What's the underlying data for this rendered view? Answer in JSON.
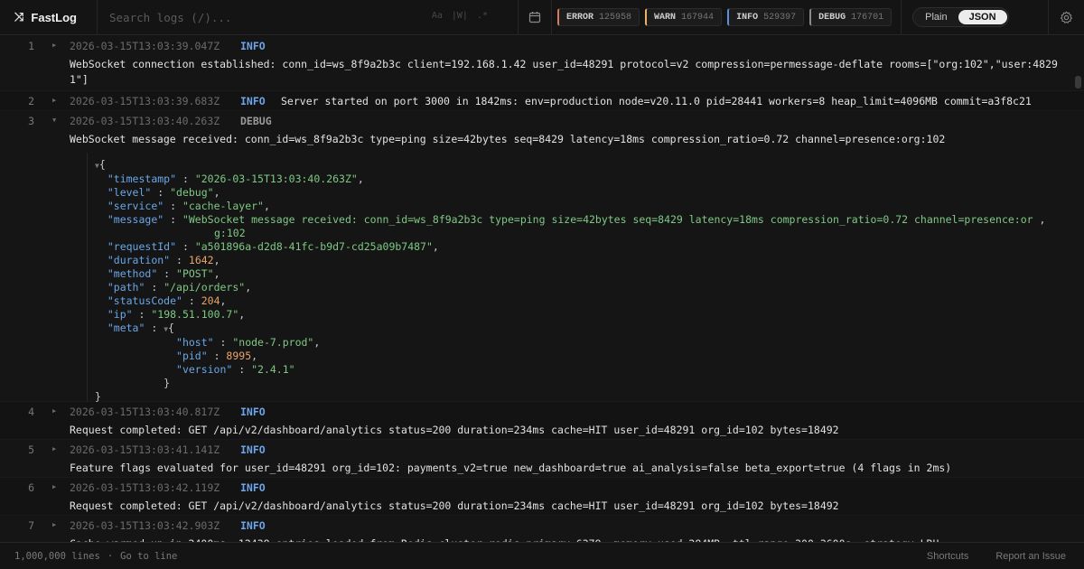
{
  "header": {
    "brand_icon": "branch-arrows-icon",
    "brand_name": "FastLog",
    "search_placeholder": "Search logs (/)...",
    "search_mods": [
      "Aa",
      "|W|",
      ".*"
    ],
    "calendar_icon": "calendar-icon",
    "badges": [
      {
        "label": "ERROR",
        "count": "125958",
        "color": "#d67a5b"
      },
      {
        "label": "WARN",
        "count": "167944",
        "color": "#e3b469"
      },
      {
        "label": "INFO",
        "count": "529397",
        "color": "#5b8fd6"
      },
      {
        "label": "DEBUG",
        "count": "176701",
        "color": "#8a8a8a"
      }
    ],
    "view_toggle": {
      "plain": "Plain",
      "json": "JSON",
      "selected": "JSON"
    },
    "settings_icon": "gear-icon"
  },
  "entries": [
    {
      "num": "1",
      "ts": "2026-03-15T13:03:39.047Z",
      "level": "INFO",
      "message": "WebSocket connection established: conn_id=ws_8f9a2b3c client=192.168.1.42 user_id=48291 protocol=v2 compression=permessage-deflate rooms=[\"org:102\",\"user:48291\"]"
    },
    {
      "num": "2",
      "ts": "2026-03-15T13:03:39.683Z",
      "level": "INFO",
      "message": "Server started on port 3000 in 1842ms: env=production node=v20.11.0 pid=28441 workers=8 heap_limit=4096MB commit=a3f8c21"
    },
    {
      "num": "3",
      "ts": "2026-03-15T13:03:40.263Z",
      "level": "DEBUG",
      "message": "WebSocket message received: conn_id=ws_8f9a2b3c type=ping size=42bytes seq=8429 latency=18ms compression_ratio=0.72 channel=presence:org:102",
      "json": {
        "timestamp": "\"2026-03-15T13:03:40.263Z\"",
        "level": "\"debug\"",
        "service": "\"cache-layer\"",
        "message_a": "\"WebSocket message received: conn_id=ws_8f9a2b3c type=ping size=42bytes seq=8429 latency=18ms compression_ratio=0.72 channel=presence:or",
        "message_b": "g:102",
        "requestId": "\"a501896a-d2d8-41fc-b9d7-cd25a09b7487\"",
        "duration": "1642",
        "method": "\"POST\"",
        "path": "\"/api/orders\"",
        "statusCode": "204",
        "ip": "\"198.51.100.7\"",
        "meta_host": "\"node-7.prod\"",
        "meta_pid": "8995",
        "meta_version": "\"2.4.1\""
      }
    },
    {
      "num": "4",
      "ts": "2026-03-15T13:03:40.817Z",
      "level": "INFO",
      "message": "Request completed: GET /api/v2/dashboard/analytics status=200 duration=234ms cache=HIT user_id=48291 org_id=102 bytes=18492"
    },
    {
      "num": "5",
      "ts": "2026-03-15T13:03:41.141Z",
      "level": "INFO",
      "message": "Feature flags evaluated for user_id=48291 org_id=102: payments_v2=true new_dashboard=true ai_analysis=false beta_export=true (4 flags in 2ms)"
    },
    {
      "num": "6",
      "ts": "2026-03-15T13:03:42.119Z",
      "level": "INFO",
      "message": "Request completed: GET /api/v2/dashboard/analytics status=200 duration=234ms cache=HIT user_id=48291 org_id=102 bytes=18492"
    },
    {
      "num": "7",
      "ts": "2026-03-15T13:03:42.903Z",
      "level": "INFO",
      "message": "Cache warmed up in 2400ms: 12438 entries loaded from Redis cluster redis-primary:6379, memory used 284MB, ttl range 300-3600s, strategy LRU"
    }
  ],
  "footer": {
    "lines": "1,000,000 lines",
    "sep": "·",
    "goto": "Go to line",
    "shortcuts": "Shortcuts",
    "report": "Report an Issue"
  }
}
